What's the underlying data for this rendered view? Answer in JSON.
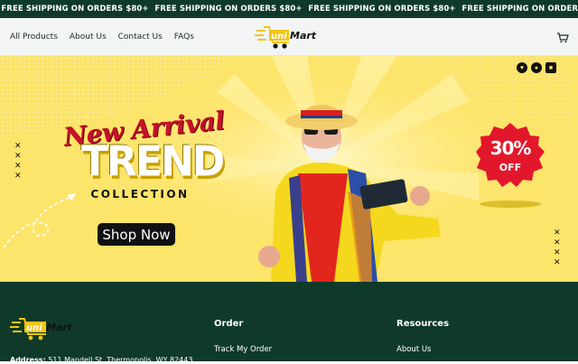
{
  "announcement": {
    "items": [
      "FREE SHIPPING ON ORDERS $80+",
      "FREE SHIPPING ON ORDERS $80+",
      "FREE SHIPPING ON ORDERS $80+",
      "FREE SHIPPING ON ORDERS $80+"
    ]
  },
  "header": {
    "nav": [
      "All Products",
      "About Us",
      "Contact Us",
      "FAQs"
    ],
    "logo": {
      "text_left": "uni",
      "text_right": "Mart"
    },
    "cart_icon": "cart-icon"
  },
  "hero": {
    "headline_script": "New Arrival",
    "headline_main": "TREND",
    "headline_sub": "COLLECTION",
    "cta_label": "Shop Now",
    "badge_percent": "30%",
    "badge_label": "OFF",
    "social_icons": [
      "heart-icon",
      "record-icon",
      "square-icon"
    ],
    "colors": {
      "background": "#fde46a",
      "badge": "#e3172c",
      "headline_red": "#c5122a",
      "button": "#111111"
    }
  },
  "footer": {
    "logo": {
      "text_left": "uni",
      "text_right": "Mart"
    },
    "address_label": "Address:",
    "address_value": "511 Mandell St, Thermopolis, WY 82443",
    "columns": [
      {
        "title": "Order",
        "links": [
          "Track My Order"
        ]
      },
      {
        "title": "Resources",
        "links": [
          "About Us"
        ]
      }
    ],
    "colors": {
      "background": "#0f3a2a"
    }
  }
}
